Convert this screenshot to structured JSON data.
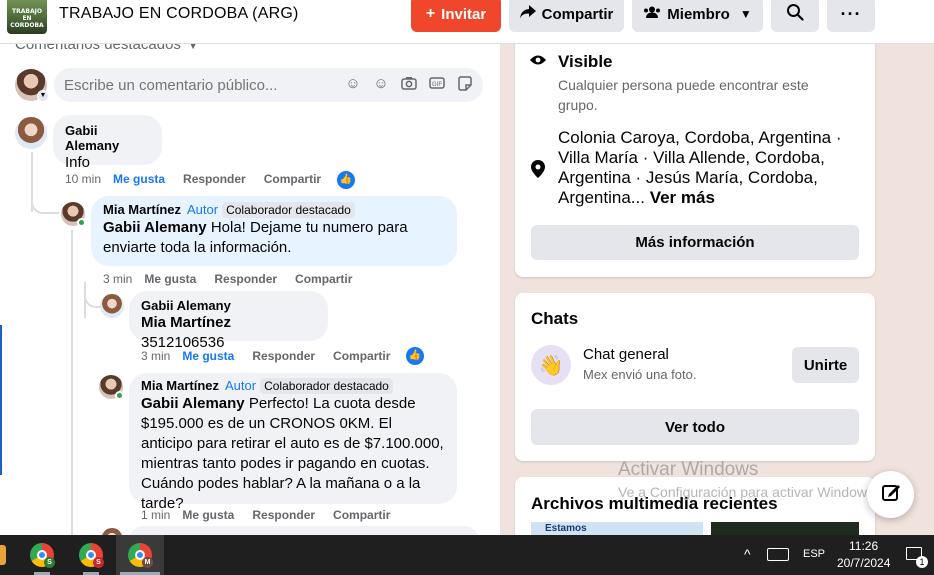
{
  "header": {
    "group_name": "TRABAJO EN CORDOBA (ARG)",
    "thumb_text": "TRABAJO EN CORDOBA",
    "invite_label": "Invitar",
    "share_label": "Compartir",
    "member_label": "Miembro"
  },
  "comments_section": {
    "featured_label": "Comentarios destacados",
    "input_placeholder": "Escribe un comentario público...",
    "comments": [
      {
        "author": "Gabii Alemany",
        "text": "Info",
        "time": "10 min",
        "like": "Me gusta",
        "reply": "Responder",
        "share": "Compartir"
      },
      {
        "author": "Mia Martínez",
        "author_tag": "Autor",
        "badge": "Colaborador destacado",
        "mention": "Gabii Alemany",
        "text": " Hola! Dejame tu numero para enviarte toda la información.",
        "time": "3 min",
        "like": "Me gusta",
        "reply": "Responder",
        "share": "Compartir"
      },
      {
        "author": "Gabii Alemany",
        "mention": "Mia Martínez",
        "text": " 3512106536",
        "time": "3 min",
        "like": "Me gusta",
        "reply": "Responder",
        "share": "Compartir"
      },
      {
        "author": "Mia Martínez",
        "author_tag": "Autor",
        "badge": "Colaborador destacado",
        "mention": "Gabii Alemany",
        "text": " Perfecto! La cuota desde $195.000 es de un CRONOS 0KM. El anticipo para retirar el auto es de $7.100.000, mientras tanto podes ir pagando en cuotas. Cuándo podes hablar? A la mañana o a la tarde?",
        "time": "1 min",
        "like": "Me gusta",
        "reply": "Responder",
        "share": "Compartir"
      }
    ]
  },
  "about": {
    "visible_title": "Visible",
    "visible_desc": "Cualquier persona puede encontrar este grupo.",
    "locations": "Colonia Caroya, Cordoba, Argentina · Villa María · Villa Allende, Cordoba, Argentina · Jesús María, Cordoba, Argentina...",
    "see_more": "Ver más",
    "more_info_label": "Más información"
  },
  "chats": {
    "title": "Chats",
    "chat_name": "Chat general",
    "chat_sub": "Mex envió una foto.",
    "join_label": "Unirte",
    "see_all_label": "Ver todo"
  },
  "media": {
    "title": "Archivos multimedia recientes",
    "thumb_text": "Estamos"
  },
  "watermark": {
    "line1": "Activar Windows",
    "line2": "Ve a Configuración para activar Windows."
  },
  "taskbar": {
    "lang": "ESP",
    "time": "11:26",
    "date": "20/7/2024",
    "notif_count": "1",
    "profile_letters": [
      "S",
      "S",
      "M"
    ]
  },
  "colors": {
    "accent": "#1877f2",
    "invite": "#f0462c",
    "online": "#31a24c"
  }
}
